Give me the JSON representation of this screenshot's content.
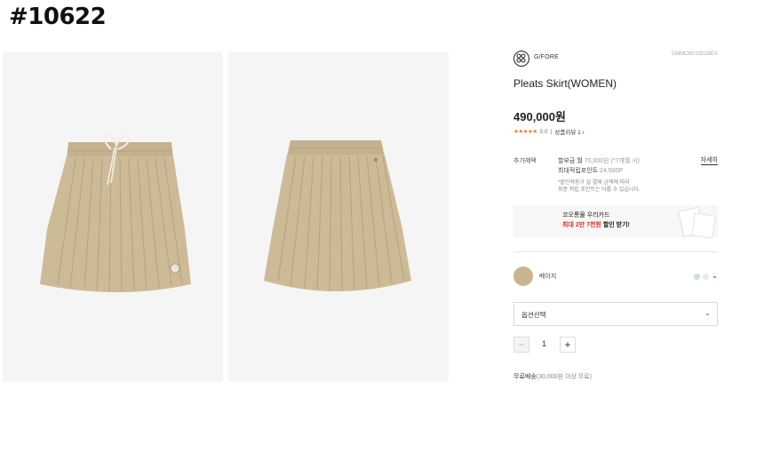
{
  "tag": "#10622",
  "product": {
    "brand_icon": "gfore-logo-icon",
    "brand": "G/FORE",
    "code": "GNMCM23301BEX",
    "title": "Pleats Skirt(WOMEN)",
    "price": "490,000원",
    "rating_stars": "★★★★★",
    "rating_value": "5.0",
    "review_link": "상품리뷰 1 ›"
  },
  "benefit": {
    "label": "추가혜택",
    "line1_prefix": "할부금 월",
    "line1_amount": "70,000원 (*7개월 시)",
    "line2_prefix": "최대적립포인트",
    "line2_amount": "24,500P",
    "detail_link": "자세히",
    "note1": "*할인적용가 실 결제 금액에 따라",
    "note2": "최종 적립 포인트는 다를 수 있습니다."
  },
  "banner": {
    "line1": "코오롱몰 우리카드",
    "line2_red": "최대 2만 7천원",
    "line2_black": "할인 받기!",
    "card_icon": "card-icon"
  },
  "color": {
    "swatch_hex": "#c7b591",
    "name": "베이지",
    "dot_colors": [
      "#c9dcec",
      "#e6e9ee"
    ],
    "chevron_icon": "chevron-down-icon"
  },
  "option_select": {
    "label": "옵션선택",
    "chevron_icon": "chevron-down-icon"
  },
  "quantity": {
    "minus": "−",
    "value": "1",
    "plus": "+"
  },
  "shipping": {
    "main": "무료배송",
    "detail": "(30,000원 이상 무료)"
  },
  "images": [
    {
      "name": "skirt-front-image",
      "color": "#c9b896"
    },
    {
      "name": "skirt-back-image",
      "color": "#c9b896"
    }
  ]
}
